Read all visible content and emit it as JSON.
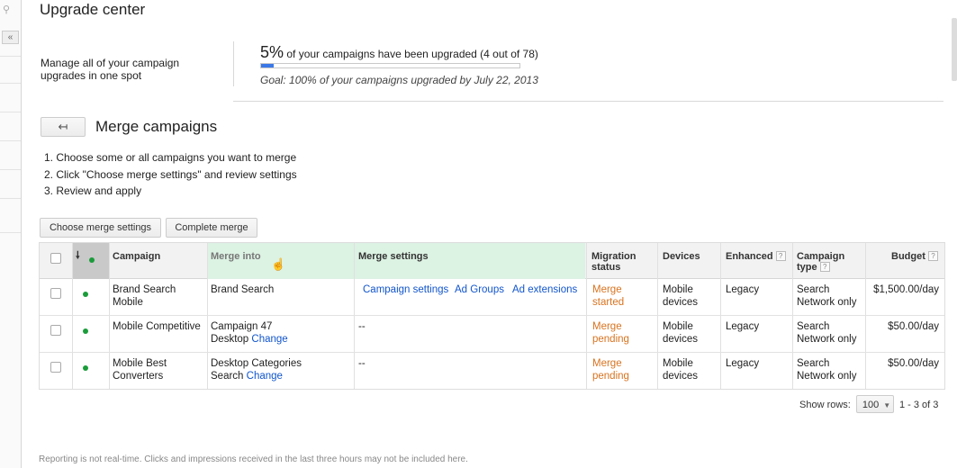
{
  "page": {
    "title": "Upgrade center"
  },
  "summary": {
    "description": "Manage all of your campaign upgrades in one spot",
    "percent": "5%",
    "progress_text": "of your campaigns have been upgraded (4 out of 78)",
    "progress_fraction": 0.05,
    "goal": "Goal: 100% of your campaigns upgraded by July 22, 2013"
  },
  "merge": {
    "back_icon": "↤",
    "title": "Merge campaigns",
    "steps": [
      "1.  Choose some or all campaigns you want to merge",
      "2.  Click \"Choose merge settings\" and review settings",
      "3.  Review and apply"
    ],
    "choose_button": "Choose merge settings",
    "complete_button": "Complete merge"
  },
  "table": {
    "headers": {
      "campaign": "Campaign",
      "merge_into": "Merge into",
      "merge_settings": "Merge settings",
      "migration_status": "Migration status",
      "devices": "Devices",
      "enhanced": "Enhanced",
      "campaign_type": "Campaign type",
      "budget": "Budget",
      "help": "?"
    },
    "rows": [
      {
        "campaign": "Brand Search Mobile",
        "merge_into": "Brand Search",
        "merge_into_change": "",
        "settings_links": [
          "Campaign settings",
          "Ad Groups",
          "Ad extensions"
        ],
        "settings_text": "",
        "status": "Merge started",
        "devices": "Mobile devices",
        "enhanced": "Legacy",
        "type": "Search Network only",
        "budget": "$1,500.00/day"
      },
      {
        "campaign": "Mobile Competitive",
        "merge_into": "Campaign 47 Desktop",
        "merge_into_change": "Change",
        "settings_links": [],
        "settings_text": "--",
        "status": "Merge pending",
        "devices": "Mobile devices",
        "enhanced": "Legacy",
        "type": "Search Network only",
        "budget": "$50.00/day"
      },
      {
        "campaign": "Mobile Best Converters",
        "merge_into": "Desktop Categories Search",
        "merge_into_change": "Change",
        "settings_links": [],
        "settings_text": "--",
        "status": "Merge pending",
        "devices": "Mobile devices",
        "enhanced": "Legacy",
        "type": "Search Network only",
        "budget": "$50.00/day"
      }
    ]
  },
  "pagination": {
    "show_rows_label": "Show rows:",
    "rows_value": "100",
    "range": "1 - 3 of 3"
  },
  "footer": {
    "disclaimer": "Reporting is not real-time. Clicks and impressions received in the last three hours may not be included here."
  },
  "colors": {
    "accent_blue": "#3b78e7",
    "link_blue": "#1155cc",
    "status_orange": "#d8731f",
    "active_green": "#1a9c3a",
    "merge_column_green": "#dcf2e3"
  }
}
